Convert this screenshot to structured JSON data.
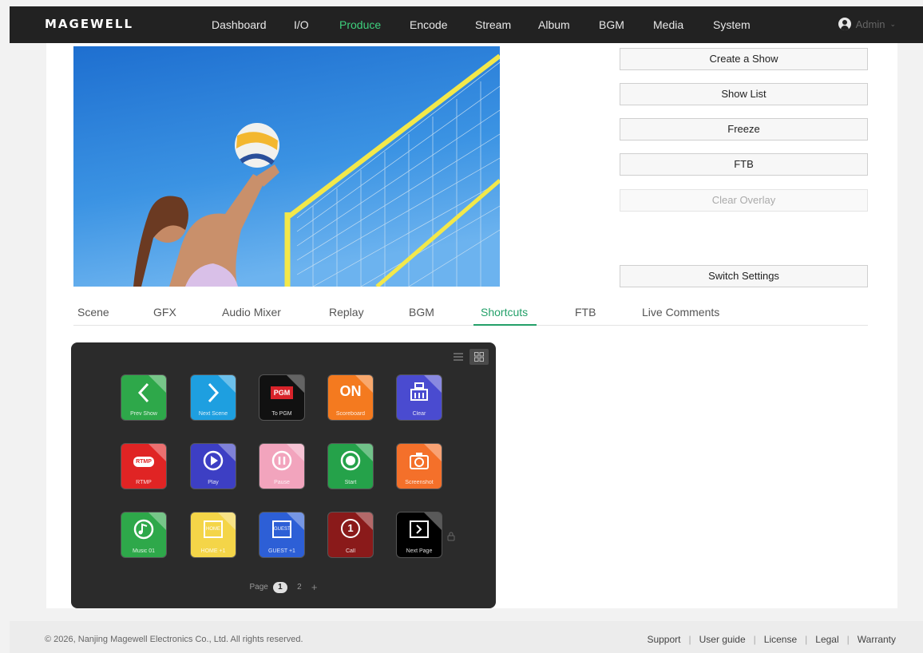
{
  "header": {
    "logo": "MAGEWELL",
    "nav": [
      {
        "label": "Dashboard",
        "active": false
      },
      {
        "label": "I/O",
        "active": false
      },
      {
        "label": "Produce",
        "active": true
      },
      {
        "label": "Encode",
        "active": false
      },
      {
        "label": "Stream",
        "active": false
      },
      {
        "label": "Album",
        "active": false
      },
      {
        "label": "BGM",
        "active": false
      },
      {
        "label": "Media",
        "active": false
      },
      {
        "label": "System",
        "active": false
      }
    ],
    "user": "Admin",
    "accent": "#3ed17d"
  },
  "controls": {
    "create_show": "Create a Show",
    "show_list": "Show List",
    "freeze": "Freeze",
    "ftb": "FTB",
    "clear_overlay": "Clear Overlay",
    "switch_settings": "Switch Settings"
  },
  "tabs": [
    {
      "label": "Scene",
      "active": false
    },
    {
      "label": "GFX",
      "active": false
    },
    {
      "label": "Audio Mixer",
      "active": false
    },
    {
      "label": "Replay",
      "active": false
    },
    {
      "label": "BGM",
      "active": false
    },
    {
      "label": "Shortcuts",
      "active": true
    },
    {
      "label": "FTB",
      "active": false
    },
    {
      "label": "Live Comments",
      "active": false
    }
  ],
  "shortcuts": {
    "keys": [
      {
        "label": "Prev Show",
        "color": "#2ea84a",
        "icon": "chevron-left-icon"
      },
      {
        "label": "Next Scene",
        "color": "#1e9fe0",
        "icon": "chevron-right-icon"
      },
      {
        "label": "To PGM",
        "color": "#111111",
        "icon": "pgm-icon",
        "icon_text": "PGM"
      },
      {
        "label": "Scoreboard",
        "color": "#f47a1f",
        "icon": "on-icon",
        "icon_text": "ON"
      },
      {
        "label": "Clear",
        "color": "#4a4bd0",
        "icon": "broom-icon"
      },
      {
        "label": "RTMP",
        "color": "#e02424",
        "icon": "rtmp-icon",
        "icon_text": "RTMP"
      },
      {
        "label": "Play",
        "color": "#3d3fc4",
        "icon": "play-icon"
      },
      {
        "label": "Pause",
        "color": "#f2a4bd",
        "icon": "pause-icon"
      },
      {
        "label": "Start",
        "color": "#25a24a",
        "icon": "record-icon"
      },
      {
        "label": "Screenshot",
        "color": "#f4702a",
        "icon": "camera-icon"
      },
      {
        "label": "Music 01",
        "color": "#2ea84a",
        "icon": "music-icon"
      },
      {
        "label": "HOME +1",
        "color": "#f4d548",
        "icon": "home-score-icon",
        "icon_text": "HOME"
      },
      {
        "label": "GUEST +1",
        "color": "#2d5fd6",
        "icon": "guest-score-icon",
        "icon_text": "GUEST"
      },
      {
        "label": "Call",
        "color": "#8a1a1a",
        "icon": "number-one-icon",
        "icon_text": "1"
      },
      {
        "label": "Next Page",
        "color": "#000000",
        "icon": "next-page-icon"
      }
    ],
    "page_label": "Page",
    "pages": [
      "1",
      "2"
    ],
    "current_page": "1"
  },
  "footer": {
    "copyright": "© 2026, Nanjing Magewell Electronics Co., Ltd. All rights reserved.",
    "links": [
      "Support",
      "User guide",
      "License",
      "Legal",
      "Warranty"
    ]
  }
}
